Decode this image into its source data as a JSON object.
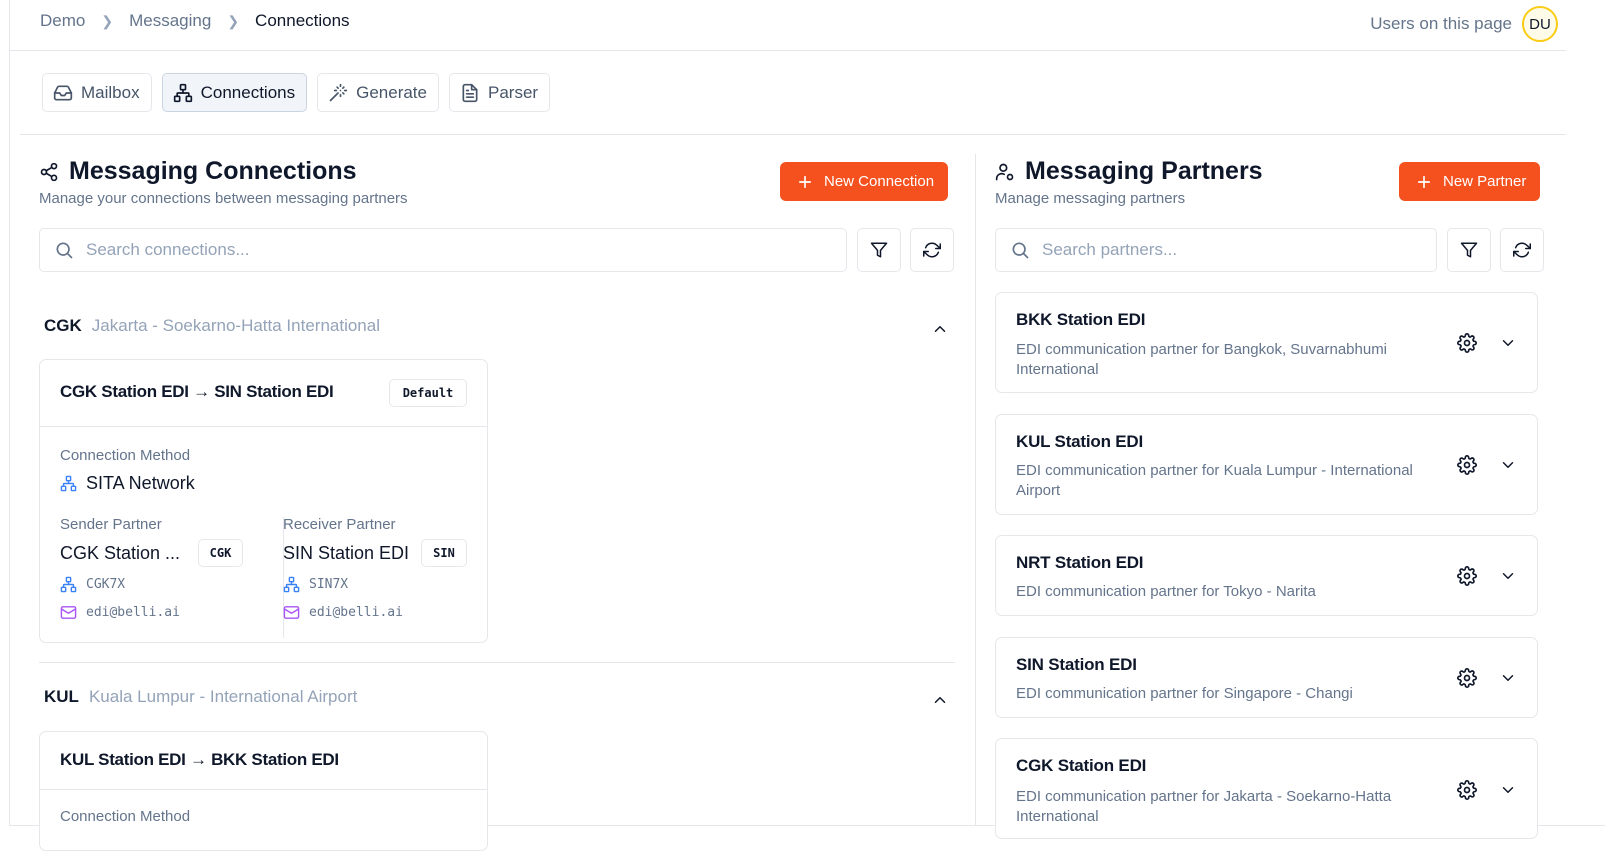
{
  "breadcrumb": [
    "Demo",
    "Messaging",
    "Connections"
  ],
  "header": {
    "users_label": "Users on this page",
    "avatar_initials": "DU"
  },
  "tabs": [
    {
      "label": "Mailbox",
      "icon": "inbox-icon"
    },
    {
      "label": "Connections",
      "icon": "network-icon",
      "active": true
    },
    {
      "label": "Generate",
      "icon": "wand-icon"
    },
    {
      "label": "Parser",
      "icon": "file-text-icon"
    }
  ],
  "connections": {
    "title": "Messaging Connections",
    "subtitle": "Manage your connections between messaging partners",
    "new_button": "New Connection",
    "search_placeholder": "Search connections...",
    "groups": [
      {
        "code": "CGK",
        "name": "Jakarta - Soekarno-Hatta International",
        "card": {
          "title": "CGK Station EDI → SIN Station EDI",
          "badge": "Default",
          "method_label": "Connection Method",
          "method": "SITA Network",
          "sender_label": "Sender Partner",
          "sender_name": "CGK Station ...",
          "sender_code": "CGK",
          "sender_address": "CGK7X",
          "sender_email": "edi@belli.ai",
          "receiver_label": "Receiver Partner",
          "receiver_name": "SIN Station EDI",
          "receiver_code": "SIN",
          "receiver_address": "SIN7X",
          "receiver_email": "edi@belli.ai"
        }
      },
      {
        "code": "KUL",
        "name": "Kuala Lumpur - International Airport",
        "card": {
          "title": "KUL Station EDI → BKK Station EDI",
          "method_label": "Connection Method"
        }
      }
    ]
  },
  "partners": {
    "title": "Messaging Partners",
    "subtitle": "Manage messaging partners",
    "new_button": "New Partner",
    "search_placeholder": "Search partners...",
    "items": [
      {
        "name": "BKK Station EDI",
        "description": "EDI communication partner for Bangkok, Suvarnabhumi International"
      },
      {
        "name": "KUL Station EDI",
        "description": "EDI communication partner for Kuala Lumpur - International Airport"
      },
      {
        "name": "NRT Station EDI",
        "description": "EDI communication partner for Tokyo - Narita"
      },
      {
        "name": "SIN Station EDI",
        "description": "EDI communication partner for Singapore - Changi"
      },
      {
        "name": "CGK Station EDI",
        "description": "EDI communication partner for Jakarta - Soekarno-Hatta International"
      }
    ]
  },
  "colors": {
    "accent": "#f4511e",
    "network_icon": "#3b82f6",
    "mail_icon": "#a855f7",
    "avatar_ring": "#facc15"
  }
}
